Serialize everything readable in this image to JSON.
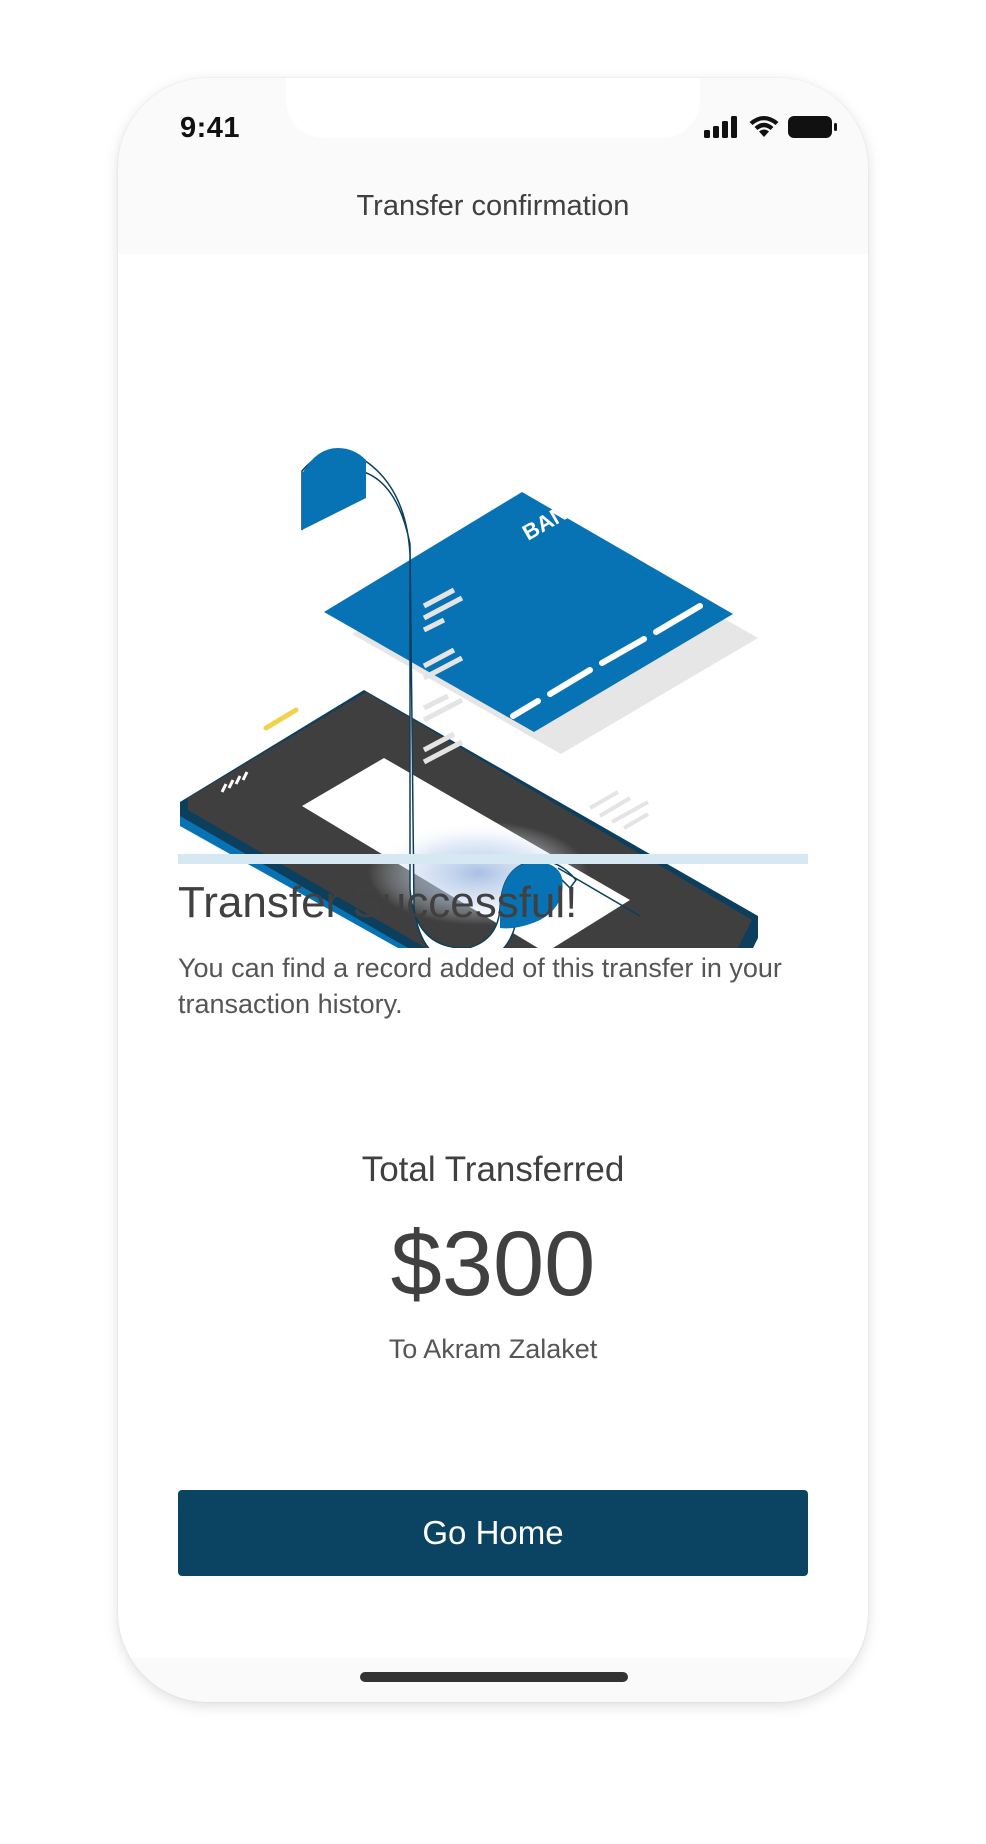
{
  "status_bar": {
    "time": "9:41",
    "icons": [
      "signal-icon",
      "wifi-icon",
      "battery-icon"
    ]
  },
  "nav": {
    "title": "Transfer confirmation"
  },
  "illustration": {
    "card_label": "BANK",
    "icon_name": "transfer-receipt-illustration"
  },
  "content": {
    "headline": "Transfer Successful!",
    "description": "You can find a record added of this transfer in your transaction history."
  },
  "summary": {
    "label": "Total Transferred",
    "amount": "$300",
    "recipient": "To Akram Zalaket"
  },
  "actions": {
    "go_home_label": "Go Home"
  },
  "colors": {
    "primary_button": "#0b4462",
    "accent_blue": "#0873b4",
    "text": "#404040",
    "divider": "#d6e8f2"
  }
}
